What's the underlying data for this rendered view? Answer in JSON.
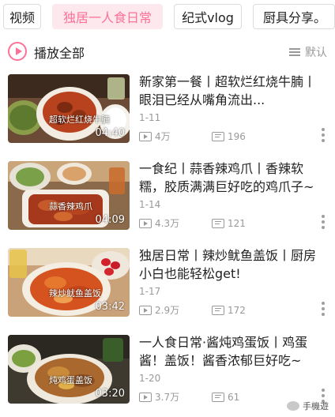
{
  "tabs": [
    {
      "label": "视频"
    },
    {
      "label": "独居一人食日常"
    },
    {
      "label": "纪式vlog"
    },
    {
      "label": "厨具分享。"
    }
  ],
  "header": {
    "play_all": "播放全部",
    "sort": "默认"
  },
  "videos": [
    {
      "title": "新家第一餐丨超软烂红烧牛腩丨眼泪已经从嘴角流出...",
      "date": "1-11",
      "views": "4万",
      "danmaku": "196",
      "duration": "04:40",
      "caption": "超软烂红烧牛腩"
    },
    {
      "title": "一食纪丨蒜香辣鸡爪丨香辣软糯，胶质满满巨好吃的鸡爪子~",
      "date": "1-14",
      "views": "4.3万",
      "danmaku": "121",
      "duration": "04:09",
      "caption": "蒜香辣鸡爪"
    },
    {
      "title": "独居日常丨辣炒鱿鱼盖饭丨厨房小白也能轻松get!",
      "date": "1-17",
      "views": "2.9万",
      "danmaku": "172",
      "duration": "03:42",
      "caption": "辣炒鱿鱼盖饭"
    },
    {
      "title": "一人食日常·酱炖鸡蛋饭丨鸡蛋酱！盖饭！酱香浓郁巨好吃~",
      "date": "1-20",
      "views": "3.7万",
      "danmaku": "61",
      "duration": "03:20",
      "caption": "炖鸡蛋盖饭"
    }
  ],
  "watermark": "手機遊",
  "colors": {
    "accent": "#fb7299",
    "chip_active_bg": "#fde8ee",
    "muted": "#999999"
  }
}
